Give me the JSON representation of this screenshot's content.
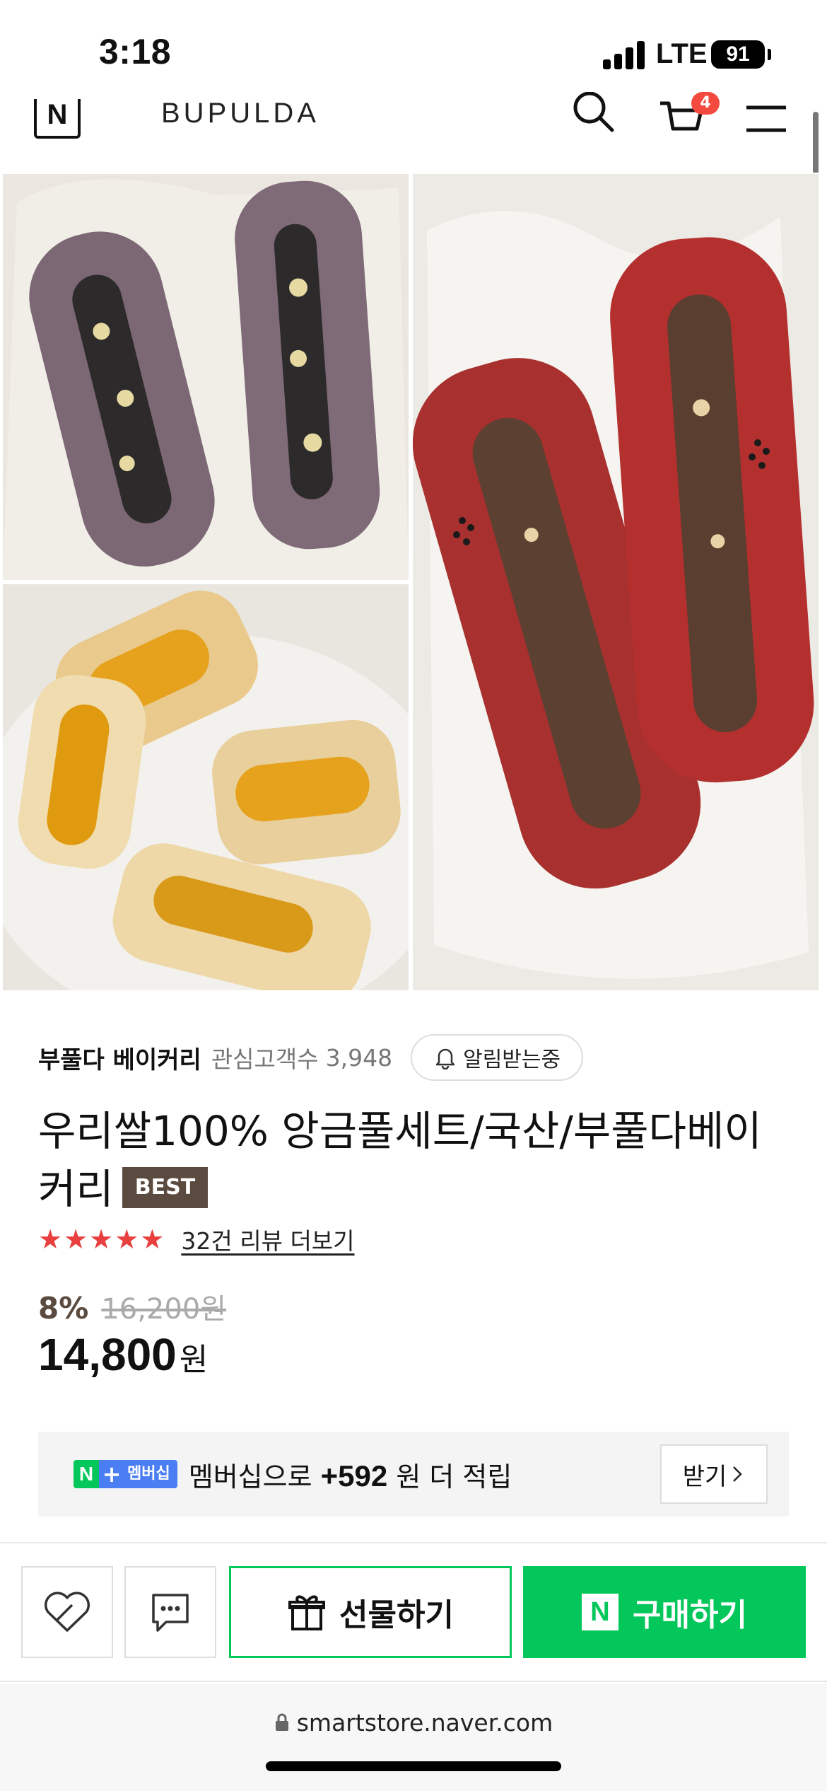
{
  "status_bar": {
    "time": "3:18",
    "network": "LTE",
    "battery": "91"
  },
  "header": {
    "logo": "N",
    "brand": "BUPULDA",
    "cart_badge": "4",
    "icons": [
      "search-icon",
      "cart-icon",
      "menu-icon"
    ]
  },
  "gallery": {
    "images": [
      "purple-bread-with-red-bean-filling",
      "red-bread-with-red-bean-filling",
      "bread-with-sweet-pumpkin-filling"
    ]
  },
  "seller": {
    "name": "부풀다 베이커리",
    "fan_label": "관심고객수",
    "fan_count": "3,948",
    "notify_label": "알림받는중"
  },
  "product": {
    "title": "우리쌀100% 앙금풀세트/국산/부풀다베이커리",
    "badge": "BEST",
    "rating_stars": 5,
    "review_link": "32건 리뷰 더보기",
    "discount": "8%",
    "original_price": "16,200원",
    "sale_price": "14,800",
    "currency": "원"
  },
  "membership": {
    "badge_n": "N",
    "badge_plus": "+",
    "badge_text": "멤버십",
    "msg_prefix": "멤버십으로",
    "points": "+592",
    "msg_suffix": "원 더 적립",
    "receive_label": "받기"
  },
  "actions": {
    "gift_label": "선물하기",
    "buy_label": "구매하기",
    "buy_icon": "N"
  },
  "browser": {
    "url": "smartstore.naver.com"
  },
  "colors": {
    "accent_green": "#03c75a",
    "star_red": "#e8403f",
    "brown": "#5b4a3f"
  }
}
